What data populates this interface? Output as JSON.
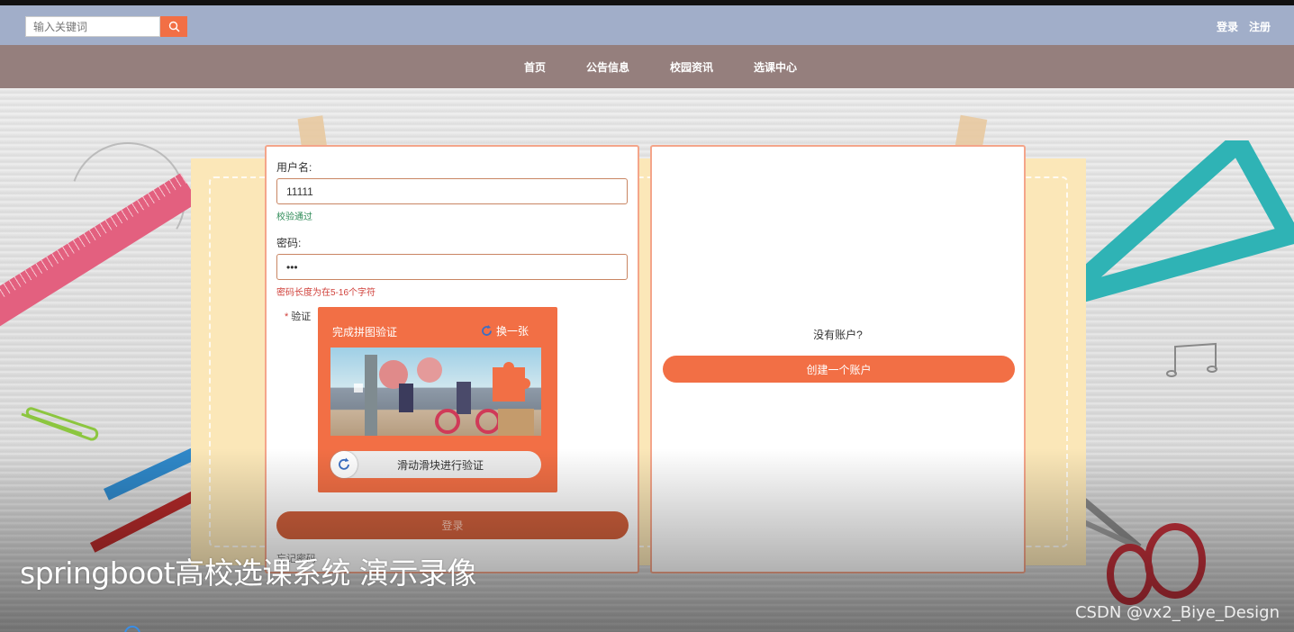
{
  "header": {
    "search_placeholder": "输入关键词",
    "search_icon": "search-icon",
    "login_link": "登录",
    "register_link": "注册"
  },
  "nav": {
    "items": [
      {
        "label": "首页"
      },
      {
        "label": "公告信息"
      },
      {
        "label": "校园资讯"
      },
      {
        "label": "选课中心"
      }
    ]
  },
  "login_form": {
    "username_label": "用户名:",
    "username_value": "11111",
    "username_hint": "校验通过",
    "password_label": "密码:",
    "password_value": "•••",
    "password_hint": "密码长度为在5-16个字符",
    "verify_label": "验证",
    "captcha": {
      "title": "完成拼图验证",
      "refresh_label": "换一张",
      "slider_text": "滑动滑块进行验证"
    },
    "login_button": "登录",
    "forgot_text": "忘记密码"
  },
  "register_panel": {
    "no_account_text": "没有账户?",
    "create_button": "创建一个账户"
  },
  "overlay": {
    "video_title": "springboot高校选课系统 演示录像",
    "watermark": "CSDN @vx2_Biye_Design"
  },
  "colors": {
    "accent": "#f26f45",
    "topbar": "#a1aec9",
    "navbar": "#957f7d"
  }
}
